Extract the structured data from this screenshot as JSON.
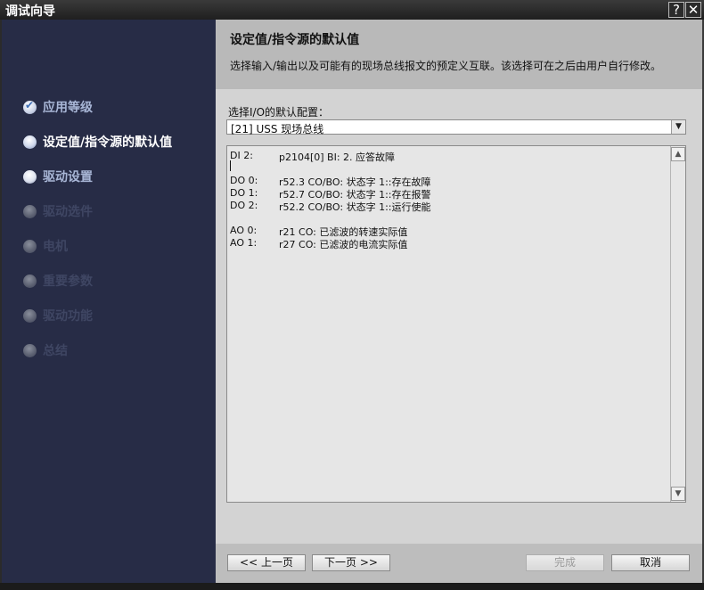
{
  "window": {
    "title": "调试向导",
    "help_label": "?",
    "close_label": "✕"
  },
  "sidebar": {
    "steps": [
      {
        "label": "应用等级",
        "state": "done"
      },
      {
        "label": "设定值/指令源的默认值",
        "state": "active"
      },
      {
        "label": "驱动设置",
        "state": "todo"
      },
      {
        "label": "驱动选件",
        "state": "disabled"
      },
      {
        "label": "电机",
        "state": "disabled"
      },
      {
        "label": "重要参数",
        "state": "disabled"
      },
      {
        "label": "驱动功能",
        "state": "disabled"
      },
      {
        "label": "总结",
        "state": "disabled"
      }
    ]
  },
  "header": {
    "title": "设定值/指令源的默认值",
    "description": "选择输入/输出以及可能有的现场总线报文的预定义互联。该选择可在之后由用户自行修改。"
  },
  "config": {
    "label": "选择I/O的默认配置：",
    "selected": "[21] USS 现场总线",
    "dropdown_arrow": "▼"
  },
  "io_list": [
    {
      "name": "DI 2:",
      "value": "p2104[0] BI: 2. 应答故障"
    },
    {
      "name": "",
      "value": ""
    },
    {
      "name": "DO 0:",
      "value": "r52.3 CO/BO: 状态字 1::存在故障"
    },
    {
      "name": "DO 1:",
      "value": "r52.7 CO/BO: 状态字 1::存在报警"
    },
    {
      "name": "DO 2:",
      "value": "r52.2 CO/BO: 状态字 1::运行使能"
    },
    {
      "name": "",
      "value": ""
    },
    {
      "name": "AO 0:",
      "value": "r21 CO: 已滤波的转速实际值"
    },
    {
      "name": "AO 1:",
      "value": "r27 CO: 已滤波的电流实际值"
    }
  ],
  "scroll": {
    "up": "▲",
    "down": "▼"
  },
  "buttons": {
    "back": "<< 上一页",
    "next": "下一页 >>",
    "finish": "完成",
    "cancel": "取消"
  },
  "colors": {
    "sidebar_bg": "#272c46",
    "header_bg": "#b9b9b9",
    "content_bg": "#d3d3d3"
  }
}
